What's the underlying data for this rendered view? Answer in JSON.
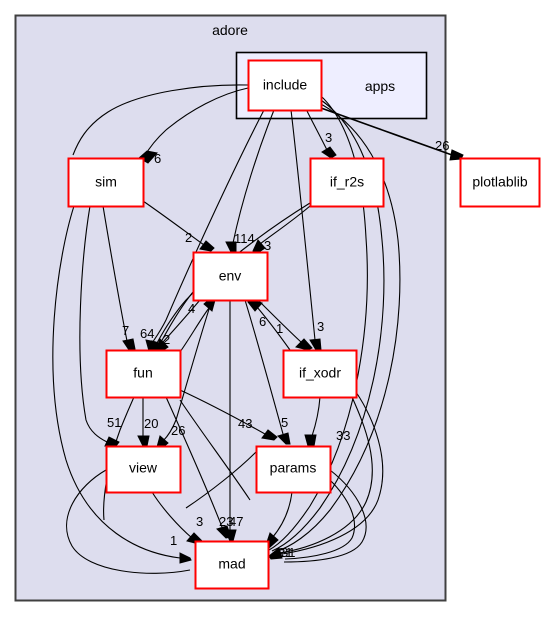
{
  "graph": {
    "type": "directory-dependency-graph",
    "background": "#ffffff",
    "cluster_fill": "#ddddee",
    "subcluster_fill": "#eeeeff",
    "node_fill": "#ffffff",
    "node_border": "#ff0000",
    "cluster_border": "#404040",
    "edge_color": "#000000"
  },
  "clusters": [
    {
      "id": "adore",
      "label": "adore"
    },
    {
      "id": "apps",
      "label": "apps"
    }
  ],
  "nodes": [
    {
      "id": "include",
      "label": "include"
    },
    {
      "id": "sim",
      "label": "sim"
    },
    {
      "id": "if_r2s",
      "label": "if_r2s"
    },
    {
      "id": "plotlablib",
      "label": "plotlablib"
    },
    {
      "id": "env",
      "label": "env"
    },
    {
      "id": "fun",
      "label": "fun"
    },
    {
      "id": "if_xodr",
      "label": "if_xodr"
    },
    {
      "id": "view",
      "label": "view"
    },
    {
      "id": "params",
      "label": "params"
    },
    {
      "id": "mad",
      "label": "mad"
    }
  ],
  "edge_labels": {
    "include_sim": "6",
    "include_if_r2s": "3",
    "include_plotlablib": "26",
    "sim_env": "2",
    "include_env": "114",
    "if_r2s_env": "3",
    "env_fun": "4",
    "sim_fun": "7",
    "include_fun": "64",
    "if_r2s_fun": "2",
    "env_if_xodr": "6",
    "if_xodr_env": "1",
    "include_if_xodr": "3",
    "sim_view": "51",
    "fun_view": "20",
    "env_view": "26",
    "fun_params": "43",
    "env_params": "5",
    "if_xodr_params": "33",
    "view_mad": "3",
    "env_mad": "23",
    "fun_mad": "47",
    "sim_mad": "1",
    "params_mad": "21",
    "if_xodr_mad": "31"
  },
  "chart_data": {
    "type": "diagram",
    "title": "adore",
    "nodes": [
      "include",
      "apps",
      "sim",
      "if_r2s",
      "plotlablib",
      "env",
      "fun",
      "if_xodr",
      "view",
      "params",
      "mad"
    ],
    "edges": [
      {
        "from": "include",
        "to": "sim",
        "weight": 6
      },
      {
        "from": "include",
        "to": "if_r2s",
        "weight": 3
      },
      {
        "from": "include",
        "to": "plotlablib",
        "weight": 26
      },
      {
        "from": "include",
        "to": "env",
        "weight": 114
      },
      {
        "from": "include",
        "to": "fun",
        "weight": 64
      },
      {
        "from": "include",
        "to": "if_xodr",
        "weight": 3
      },
      {
        "from": "sim",
        "to": "env",
        "weight": 2
      },
      {
        "from": "sim",
        "to": "fun",
        "weight": 7
      },
      {
        "from": "sim",
        "to": "view",
        "weight": 51
      },
      {
        "from": "sim",
        "to": "mad",
        "weight": 1
      },
      {
        "from": "if_r2s",
        "to": "env",
        "weight": 3
      },
      {
        "from": "if_r2s",
        "to": "fun",
        "weight": 2
      },
      {
        "from": "env",
        "to": "fun",
        "weight": 4
      },
      {
        "from": "env",
        "to": "if_xodr",
        "weight": 6
      },
      {
        "from": "env",
        "to": "view",
        "weight": 26
      },
      {
        "from": "env",
        "to": "params",
        "weight": 5
      },
      {
        "from": "env",
        "to": "mad",
        "weight": 23
      },
      {
        "from": "if_xodr",
        "to": "env",
        "weight": 1
      },
      {
        "from": "if_xodr",
        "to": "params",
        "weight": 33
      },
      {
        "from": "if_xodr",
        "to": "mad",
        "weight": 31
      },
      {
        "from": "fun",
        "to": "view",
        "weight": 20
      },
      {
        "from": "fun",
        "to": "params",
        "weight": 43
      },
      {
        "from": "fun",
        "to": "mad",
        "weight": 47
      },
      {
        "from": "view",
        "to": "mad",
        "weight": 3
      },
      {
        "from": "params",
        "to": "mad",
        "weight": 21
      }
    ]
  }
}
